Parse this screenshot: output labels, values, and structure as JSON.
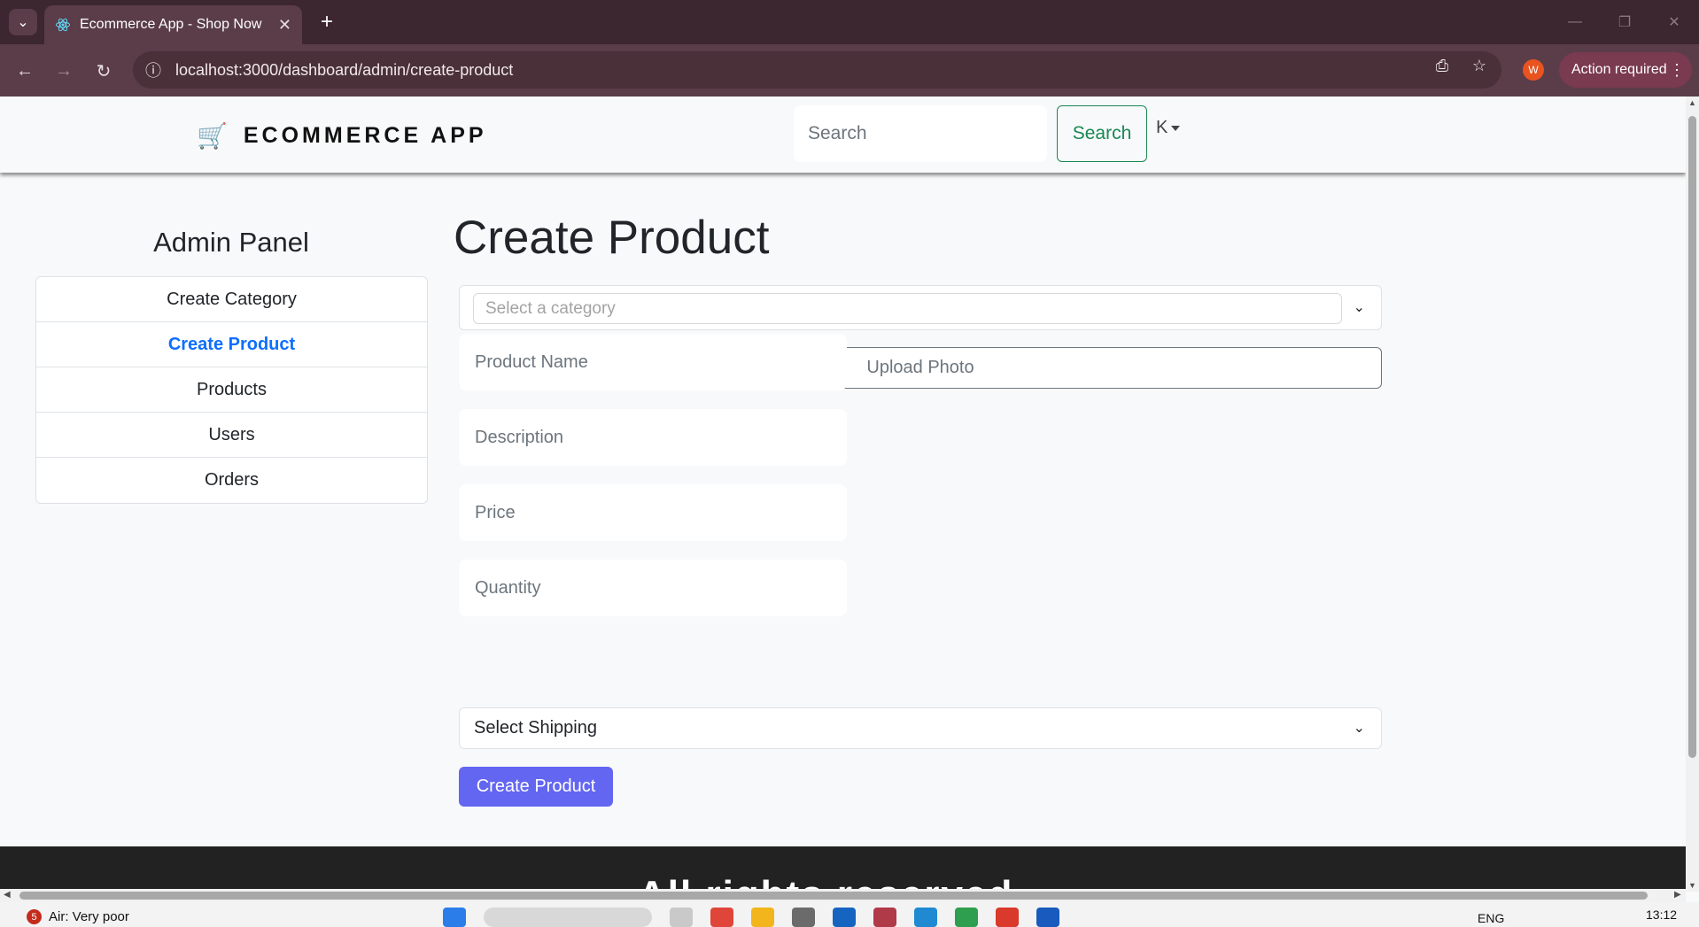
{
  "browser": {
    "tab_title": "Ecommerce App - Shop Now",
    "url": "localhost:3000/dashboard/admin/create-product",
    "action_required_label": "Action required",
    "profile_initial": "W"
  },
  "navbar": {
    "brand": "ECOMMERCE APP",
    "search_placeholder": "Search",
    "search_button": "Search",
    "user_initial": "K"
  },
  "sidebar": {
    "title": "Admin Panel",
    "items": [
      {
        "label": "Create Category",
        "active": false
      },
      {
        "label": "Create Product",
        "active": true
      },
      {
        "label": "Products",
        "active": false
      },
      {
        "label": "Users",
        "active": false
      },
      {
        "label": "Orders",
        "active": false
      }
    ]
  },
  "form": {
    "title": "Create Product",
    "category_placeholder": "Select a category",
    "upload_label": "Upload Photo",
    "name_placeholder": "Product Name",
    "description_placeholder": "Description",
    "price_placeholder": "Price",
    "quantity_placeholder": "Quantity",
    "shipping_label": "Select Shipping",
    "submit_label": "Create Product"
  },
  "footer": {
    "text": "All rights reserved"
  },
  "taskbar": {
    "notification_count": "5",
    "status": "Air: Very poor",
    "language": "ENG",
    "time": "13:12"
  },
  "colors": {
    "accent": "#6366f1",
    "active_link": "#0d6efd",
    "search_green": "#198754"
  }
}
